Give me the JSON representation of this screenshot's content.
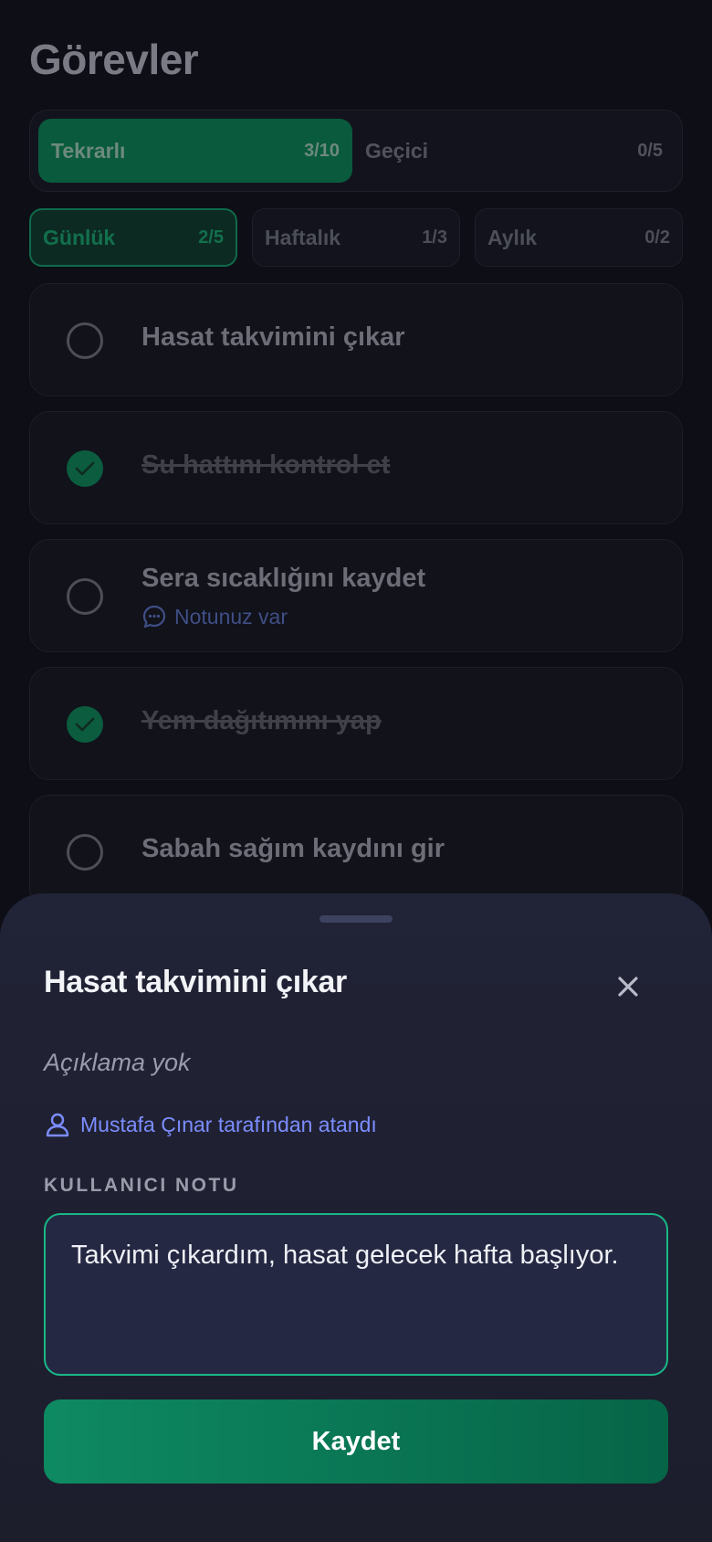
{
  "header": {
    "title": "Görevler"
  },
  "segments": [
    {
      "label": "Tekrarlı",
      "count": "3/10",
      "active": true
    },
    {
      "label": "Geçici",
      "count": "0/5",
      "active": false
    }
  ],
  "periods": [
    {
      "label": "Günlük",
      "count": "2/5",
      "active": true
    },
    {
      "label": "Haftalık",
      "count": "1/3",
      "active": false
    },
    {
      "label": "Aylık",
      "count": "0/2",
      "active": false
    }
  ],
  "tasks": [
    {
      "title": "Hasat takvimini çıkar",
      "done": false
    },
    {
      "title": "Su hattını kontrol et",
      "done": true
    },
    {
      "title": "Sera sıcaklığını kaydet",
      "done": false,
      "note_label": "Notunuz var"
    },
    {
      "title": "Yem dağıtımını yap",
      "done": true
    },
    {
      "title": "Sabah sağım kaydını gir",
      "done": false
    }
  ],
  "sheet": {
    "title": "Hasat takvimini çıkar",
    "description": "Açıklama yok",
    "assigned_by": "Mustafa Çınar tarafından atandı",
    "note_section_label": "KULLANICI NOTU",
    "note_value": "Takvimi çıkardım, hasat gelecek hafta başlıyor.",
    "save_label": "Kaydet"
  },
  "colors": {
    "accent": "#10b981",
    "link": "#7c8dff",
    "sheet_bg": "#1f2133"
  }
}
